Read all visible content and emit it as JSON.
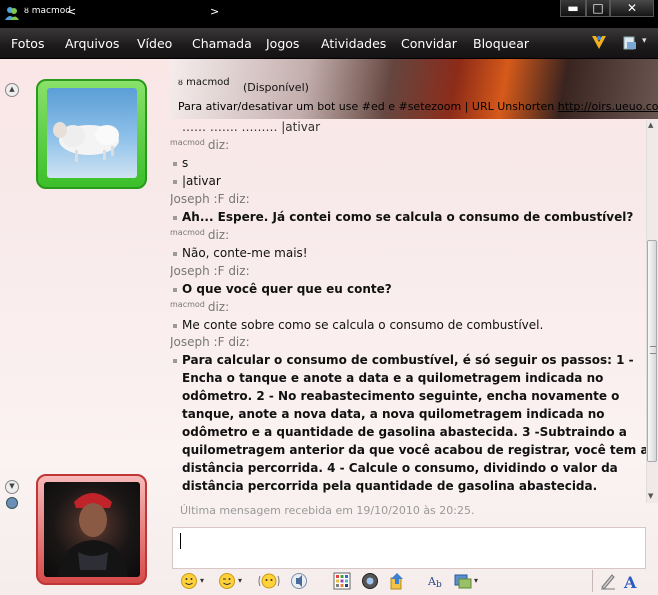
{
  "window": {
    "title": "macmod",
    "title_arrow_1": "<",
    "title_arrow_2": ">",
    "minimize": "▬",
    "maximize": "□",
    "close": "✕"
  },
  "menu": {
    "items": [
      "Fotos",
      "Arquivos",
      "Vídeo",
      "Chamada",
      "Jogos",
      "Atividades",
      "Convidar",
      "Bloquear"
    ]
  },
  "contact": {
    "name": "macmod",
    "status": "(Disponível)",
    "psm": "Para ativar/desativar um bot use #ed e #setezoom | URL Unshorten ",
    "url": "http://oirs.ueuo.com/..."
  },
  "conversation": {
    "partial_top": "…… ……. ……… |ativar",
    "macmod_label": "macmod",
    "diz": "diz:",
    "joseph_sender": "Joseph :F diz:",
    "messages": {
      "m1": "s",
      "m2": "|ativar",
      "m3": "Ah... Espere. Já contei como se calcula o consumo de combustível?",
      "m4": "Não, conte-me mais!",
      "m5": "O que você quer que eu conte?",
      "m6": "Me conte sobre como se calcula o consumo de combustível.",
      "m7_lines": [
        "Para calcular o consumo de combustível, é só seguir os passos: 1 -",
        "Encha o tanque e anote a data e a quilometragem indicada no",
        "odômetro. 2 - No reabastecimento seguinte, encha novamente o",
        "tanque, anote a nova data, a nova quilometragem indicada no",
        "odômetro e a quantidade de gasolina abastecida. 3 -Subtraindo a",
        "quilometragem anterior da que você acabou de registrar, você tem a",
        "distância percorrida. 4 - Calcule o consumo, dividindo o valor da",
        "distância percorrida pela quantidade de gasolina abastecida."
      ]
    }
  },
  "footer": {
    "last_message": "Última mensagem recebida em 19/10/2010 às 20:25."
  },
  "input": {
    "value": ""
  },
  "toolbar": {
    "icons": [
      "emoticon-icon",
      "wink-icon",
      "nudge-icon",
      "voice-clip-icon",
      "background-icon",
      "send-file-icon",
      "share-icon",
      "font-icon",
      "color-icon",
      "handwriting-icon",
      "text-style-icon"
    ],
    "font_label": "A",
    "caret": "▾"
  }
}
